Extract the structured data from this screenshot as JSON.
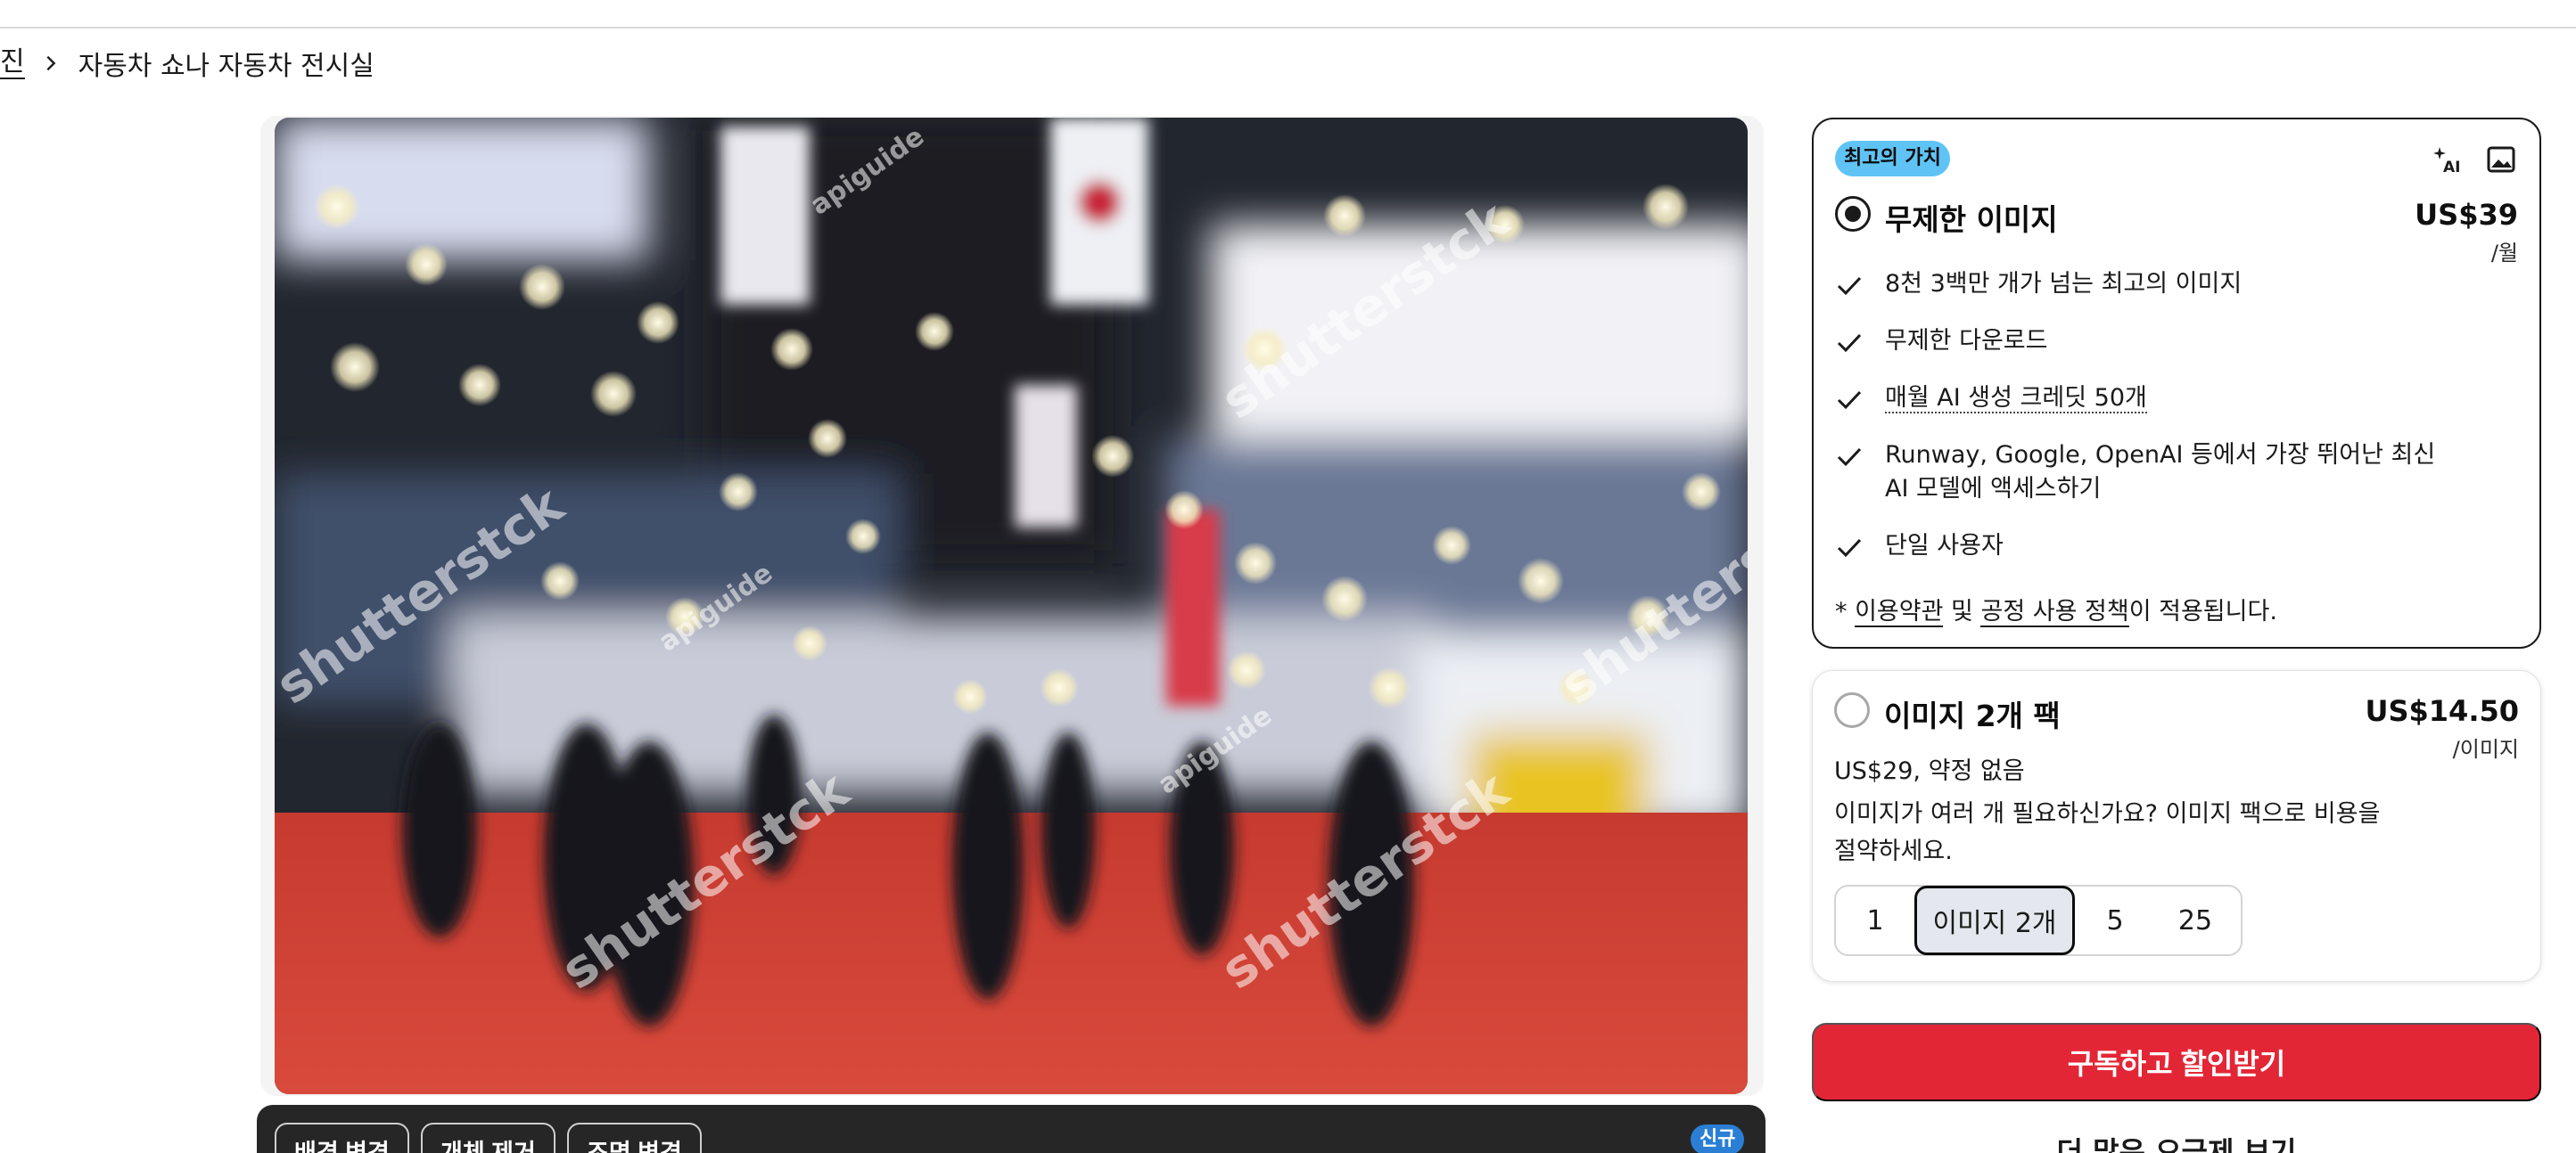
{
  "breadcrumb": {
    "prev": "진",
    "current": "자동차 쇼나 자동차 전시실"
  },
  "editor": {
    "buttons": [
      "배경 변경",
      "개체 제거",
      "조명 변경"
    ],
    "new_badge": "신규"
  },
  "image": {
    "watermarks": [
      "shutterstck",
      "apiguide"
    ]
  },
  "plans": {
    "unlimited": {
      "badge": "최고의 가치",
      "title": "무제한 이미지",
      "price": "US$39",
      "per": "/월",
      "selected": true,
      "ai_icon_label": "AI",
      "features": [
        "8천 3백만 개가 넘는 최고의 이미지",
        "무제한 다운로드",
        "매월 AI 생성 크레딧 50개",
        "Runway, Google, OpenAI 등에서 가장 뛰어난 최신 AI 모델에 액세스하기",
        "단일 사용자"
      ],
      "terms": {
        "prefix": "* ",
        "link1": "이용약관",
        "mid": " 및 ",
        "link2": "공정 사용 정책",
        "suffix": "이 적용됩니다."
      }
    },
    "pack": {
      "title": "이미지 2개 팩",
      "price": "US$14.50",
      "per": "/이미지",
      "selected": false,
      "subline": "US$29, 약정 없음",
      "description": "이미지가 여러 개 필요하신가요? 이미지 팩으로 비용을 절약하세요.",
      "options": [
        "1",
        "이미지 2개",
        "5",
        "25"
      ],
      "selected_option": "이미지 2개"
    }
  },
  "cta": {
    "label": "구독하고 할인받기"
  },
  "more_plans": {
    "label": "더 많은 요금제 보기"
  },
  "colors": {
    "cta": "#e32636",
    "badge": "#5fc3f5",
    "new_badge": "#2a7fd4"
  }
}
